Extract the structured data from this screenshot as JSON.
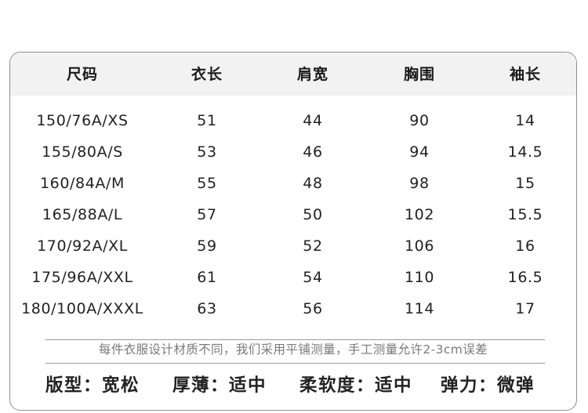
{
  "table": {
    "headers": [
      "尺码",
      "衣长",
      "肩宽",
      "胸围",
      "袖长"
    ],
    "rows": [
      [
        "150/76A/XS",
        "51",
        "44",
        "90",
        "14"
      ],
      [
        "155/80A/S",
        "53",
        "46",
        "94",
        "14.5"
      ],
      [
        "160/84A/M",
        "55",
        "48",
        "98",
        "15"
      ],
      [
        "165/88A/L",
        "57",
        "50",
        "102",
        "15.5"
      ],
      [
        "170/92A/XL",
        "59",
        "52",
        "106",
        "16"
      ],
      [
        "175/96A/XXL",
        "61",
        "54",
        "110",
        "16.5"
      ],
      [
        "180/100A/XXXL",
        "63",
        "56",
        "114",
        "17"
      ]
    ]
  },
  "note": "每件衣服设计材质不同，我们采用平铺测量，手工测量允许2-3cm误差",
  "properties": [
    "版型：宽松",
    "厚薄：适中",
    "柔软度：适中",
    "弹力：微弹"
  ]
}
